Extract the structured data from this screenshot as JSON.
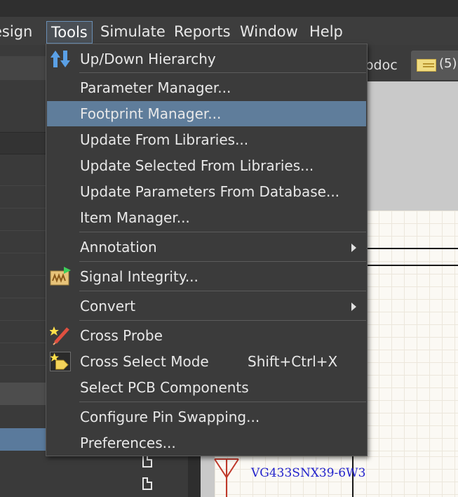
{
  "menubar": {
    "items": [
      {
        "label": "Design",
        "visible_text": "esign"
      },
      {
        "label": "Tools"
      },
      {
        "label": "Simulate"
      },
      {
        "label": "Reports"
      },
      {
        "label": "Window"
      },
      {
        "label": "Help"
      }
    ]
  },
  "tabs": {
    "partial_tab_label": "cbdoc",
    "folder_tab_count": "(5)"
  },
  "tools_menu": {
    "items": [
      {
        "label": "Up/Down Hierarchy",
        "icon": "up-down-arrows-icon"
      },
      {
        "label": "Parameter Manager..."
      },
      {
        "label": "Footprint Manager...",
        "highlighted": true
      },
      {
        "label": "Update From Libraries..."
      },
      {
        "label": "Update Selected From Libraries..."
      },
      {
        "label": "Update Parameters From Database..."
      },
      {
        "label": "Item Manager..."
      },
      {
        "label": "Annotation",
        "submenu": true
      },
      {
        "label": "Signal Integrity...",
        "icon": "signal-integrity-icon"
      },
      {
        "label": "Convert",
        "submenu": true
      },
      {
        "label": "Cross Probe",
        "icon": "cross-probe-icon"
      },
      {
        "label": "Cross Select Mode",
        "icon": "cross-select-mode-icon",
        "shortcut": "Shift+Ctrl+X"
      },
      {
        "label": "Select PCB Components"
      },
      {
        "label": "Configure Pin Swapping..."
      },
      {
        "label": "Preferences..."
      }
    ]
  },
  "schematic": {
    "part_label": "VG433SNX39-6W3"
  },
  "colors": {
    "menu_highlight": "#5f7d9b",
    "part_label": "#2222cc",
    "folder_icon": "#f0dc82"
  }
}
